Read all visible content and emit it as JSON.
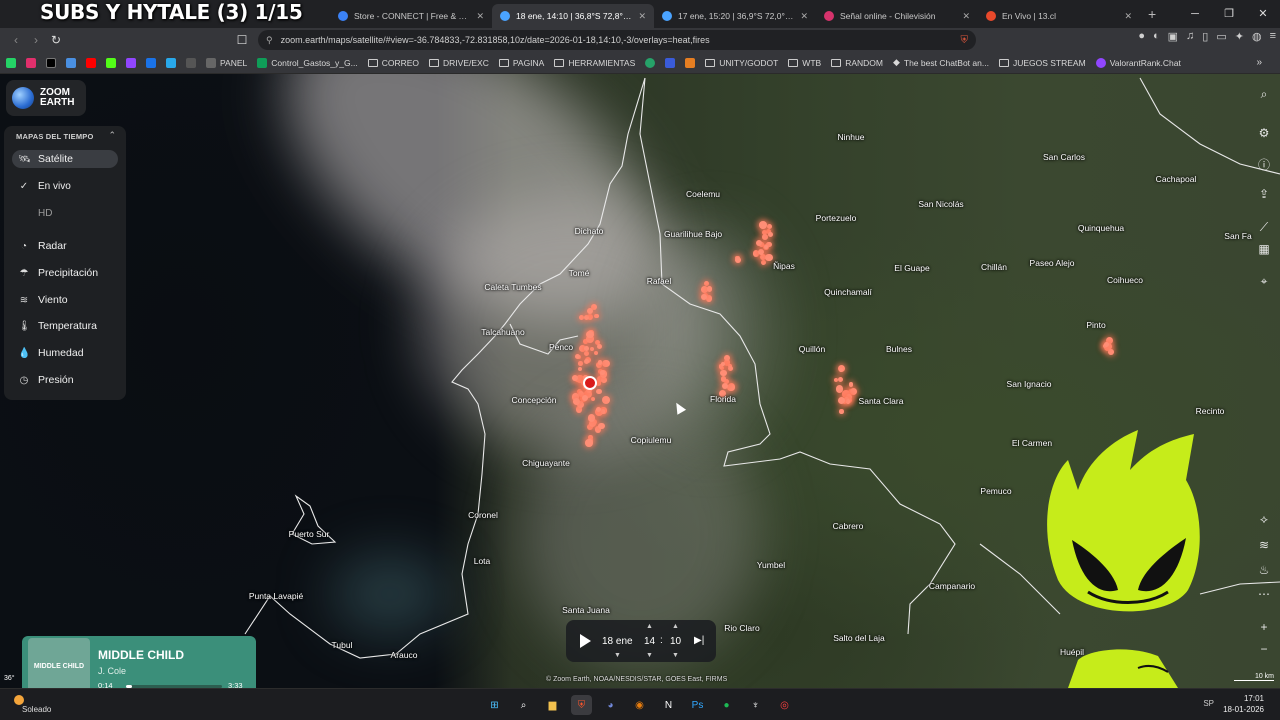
{
  "stream_overlay": {
    "title": "SUBS Y HYTALE (3) 1/15"
  },
  "tabs": [
    {
      "label": "Store - CONNECT | Free & Premium",
      "color": "#3b82f6",
      "active": false
    },
    {
      "label": "18 ene, 14:10 | 36,8°S 72,8°O | Z",
      "color": "#4aa3ff",
      "active": true
    },
    {
      "label": "17 ene, 15:20 | 36,9°S 72,0°O | Zoom",
      "color": "#4aa3ff",
      "active": false
    },
    {
      "label": "Señal online - Chilevisión",
      "color": "#d6336c",
      "active": false
    },
    {
      "label": "En Vivo | 13.cl",
      "color": "#e8492b",
      "active": false
    }
  ],
  "address": {
    "url": "zoom.earth/maps/satellite/#view=-36.784833,-72.831858,10z/date=2026-01-18,14:10,-3/overlays=heat,fires"
  },
  "bookmarks": [
    {
      "label": "PANEL",
      "type": "site"
    },
    {
      "label": "Control_Gastos_y_G...",
      "type": "site"
    },
    {
      "label": "CORREO",
      "type": "folder"
    },
    {
      "label": "DRIVE/EXC",
      "type": "folder"
    },
    {
      "label": "PAGINA",
      "type": "folder"
    },
    {
      "label": "HERRAMIENTAS",
      "type": "folder"
    },
    {
      "label": "UNITY/GODOT",
      "type": "folder"
    },
    {
      "label": "WTB",
      "type": "folder"
    },
    {
      "label": "RANDOM",
      "type": "folder"
    },
    {
      "label": "The best ChatBot an...",
      "type": "site"
    },
    {
      "label": "JUEGOS STREAM",
      "type": "folder"
    },
    {
      "label": "ValorantRank.Chat",
      "type": "site"
    }
  ],
  "sidebar": {
    "logo": {
      "line1": "ZOOM",
      "line2": "EARTH"
    },
    "header": "MAPAS DEL TIEMPO",
    "items": [
      {
        "label": "Satélite",
        "icon": "satellite-icon"
      },
      {
        "label": "En vivo",
        "icon": "check-icon"
      },
      {
        "label": "HD",
        "icon": ""
      },
      {
        "label": "Radar",
        "icon": "radar-icon"
      },
      {
        "label": "Precipitación",
        "icon": "rain-icon"
      },
      {
        "label": "Viento",
        "icon": "wind-icon"
      },
      {
        "label": "Temperatura",
        "icon": "thermometer-icon"
      },
      {
        "label": "Humedad",
        "icon": "humidity-icon"
      },
      {
        "label": "Presión",
        "icon": "pressure-icon"
      }
    ]
  },
  "places": [
    {
      "name": "Ninhue"
    },
    {
      "name": "San Carlos"
    },
    {
      "name": "Cachapoal"
    },
    {
      "name": "Coelemu"
    },
    {
      "name": "San Nicolás"
    },
    {
      "name": "Portezuelo"
    },
    {
      "name": "Quinquehua"
    },
    {
      "name": "Dichato"
    },
    {
      "name": "Guarilihue Bajo"
    },
    {
      "name": "Ñipas"
    },
    {
      "name": "El Guape"
    },
    {
      "name": "Chillán"
    },
    {
      "name": "Paseo Alejo"
    },
    {
      "name": "San Fa"
    },
    {
      "name": "Tomé"
    },
    {
      "name": "Rafael"
    },
    {
      "name": "Quinchamalí"
    },
    {
      "name": "Coihueco"
    },
    {
      "name": "Caleta Tumbes"
    },
    {
      "name": "Talcahuano"
    },
    {
      "name": "Penco"
    },
    {
      "name": "Quillón"
    },
    {
      "name": "Bulnes"
    },
    {
      "name": "Pinto"
    },
    {
      "name": "Concepción"
    },
    {
      "name": "Florida"
    },
    {
      "name": "Santa Clara"
    },
    {
      "name": "San Ignacio"
    },
    {
      "name": "Recinto"
    },
    {
      "name": "Copiulemu"
    },
    {
      "name": "El Carmen"
    },
    {
      "name": "Chiguayante"
    },
    {
      "name": "Coronel"
    },
    {
      "name": "Pemuco"
    },
    {
      "name": "Cabrero"
    },
    {
      "name": "Puerto Sur"
    },
    {
      "name": "Lota"
    },
    {
      "name": "Yumbel"
    },
    {
      "name": "Campanario"
    },
    {
      "name": "Punta Lavapié"
    },
    {
      "name": "Santa Juana"
    },
    {
      "name": "Rio Claro"
    },
    {
      "name": "Salto del Laja"
    },
    {
      "name": "Tubul"
    },
    {
      "name": "Arauco"
    },
    {
      "name": "Huépil"
    }
  ],
  "time_control": {
    "date": "18 ene",
    "hour": "14",
    "minute": "10"
  },
  "credit": "© Zoom Earth, NOAA/NESDIS/STAR, GOES East, FIRMS",
  "scale": "10 km",
  "coords_snippet": "36°",
  "music": {
    "album_text": "MIDDLE CHILD",
    "song": "MIDDLE CHILD",
    "artist": "J. Cole",
    "current": "0:14",
    "total": "3:33",
    "progress": 0.066
  },
  "taskbar": {
    "weather": "Soleado",
    "time": "17:01",
    "date": "18-01-2026",
    "lang": "SP"
  },
  "colors": {
    "fire": "#ff8e76",
    "fire_marker": "#d91c1c",
    "panel": "#1e2023",
    "mascot": "#c6ec1a"
  }
}
